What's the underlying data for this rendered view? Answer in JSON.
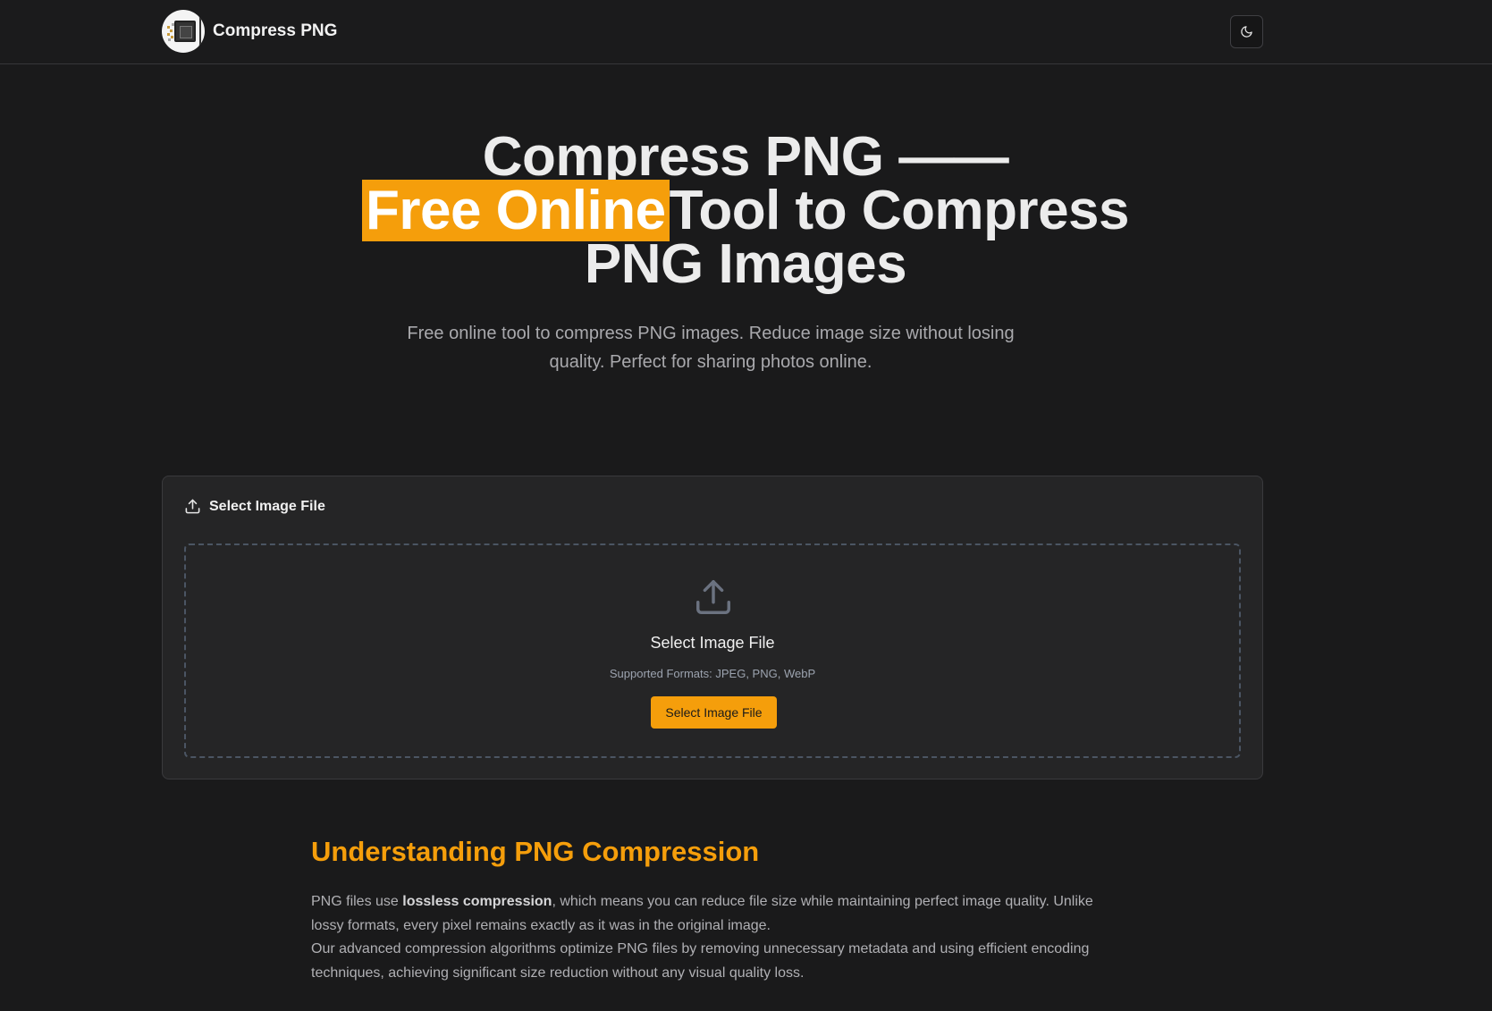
{
  "header": {
    "brand_name": "Compress PNG",
    "logo_icon": "logo-icon",
    "theme_toggle_icon": "moon-icon"
  },
  "hero": {
    "title_line1": "Compress PNG ——",
    "title_highlight": "Free Online",
    "title_line2_rest": "Tool to Compress",
    "title_line3": "PNG Images",
    "subtitle": "Free online tool to compress PNG images. Reduce image size without losing quality. Perfect for sharing photos online."
  },
  "upload_card": {
    "header_icon": "upload-icon",
    "header_label": "Select Image File",
    "dropzone": {
      "icon": "upload-icon",
      "title": "Select Image File",
      "formats": "Supported Formats: JPEG, PNG, WebP",
      "button_label": "Select Image File"
    }
  },
  "article": {
    "title": "Understanding PNG Compression",
    "p1_before": "PNG files use ",
    "p1_bold": "lossless compression",
    "p1_after": ", which means you can reduce file size while maintaining perfect image quality. Unlike lossy formats, every pixel remains exactly as it was in the original image.",
    "p2": "Our advanced compression algorithms optimize PNG files by removing unnecessary metadata and using efficient encoding techniques, achieving significant size reduction without any visual quality loss."
  },
  "colors": {
    "accent": "#f59e0b",
    "background": "#1a1a1b",
    "card": "#252526"
  }
}
